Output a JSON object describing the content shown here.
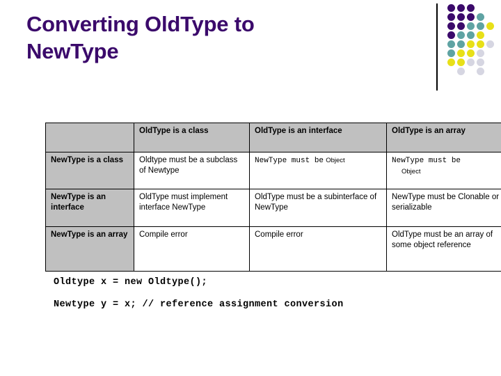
{
  "slide": {
    "title_line1": "Converting OldType to",
    "title_line2": "NewType",
    "title_color": "#3B0A6B"
  },
  "decoration": {
    "name": "dot-grid-accent",
    "colors": {
      "purple": "#3B0A6B",
      "teal": "#5FA3A3",
      "yellow": "#E8E018",
      "lightgray": "#D6D6E2"
    },
    "grid": [
      [
        "purple",
        "purple",
        "purple",
        null,
        null
      ],
      [
        "purple",
        "purple",
        "purple",
        "teal",
        null
      ],
      [
        "purple",
        "purple",
        "teal",
        "teal",
        "yellow"
      ],
      [
        "purple",
        "teal",
        "teal",
        "yellow",
        null
      ],
      [
        "teal",
        "teal",
        "yellow",
        "yellow",
        "lightgray"
      ],
      [
        "teal",
        "yellow",
        "yellow",
        "lightgray",
        null
      ],
      [
        "yellow",
        "yellow",
        "lightgray",
        "lightgray",
        null
      ],
      [
        null,
        "lightgray",
        null,
        "lightgray",
        null
      ]
    ]
  },
  "table": {
    "corner_label": "",
    "headers": [
      "OldType is a class",
      "OldType is an interface",
      "OldType is an array"
    ],
    "rows": [
      {
        "header": "NewType is a class",
        "cells": [
          "Oldtype  must be a subclass of Newtype",
          "NewType must be Object",
          "NewType must be Object"
        ]
      },
      {
        "header": "NewType is an interface",
        "cells": [
          "OldType  must implement interface NewType",
          "OldType  must be a subinterface of NewType",
          "NewType must be Clonable or serializable"
        ]
      },
      {
        "header": "NewType is an array",
        "cells": [
          "Compile error",
          "Compile error",
          "OldType  must be an array of some object reference"
        ]
      }
    ],
    "header_bg": "#C0C0C0"
  },
  "code": {
    "line1": "Oldtype x = new Oldtype();",
    "line2": "Newtype y = x; // reference assignment conversion"
  }
}
